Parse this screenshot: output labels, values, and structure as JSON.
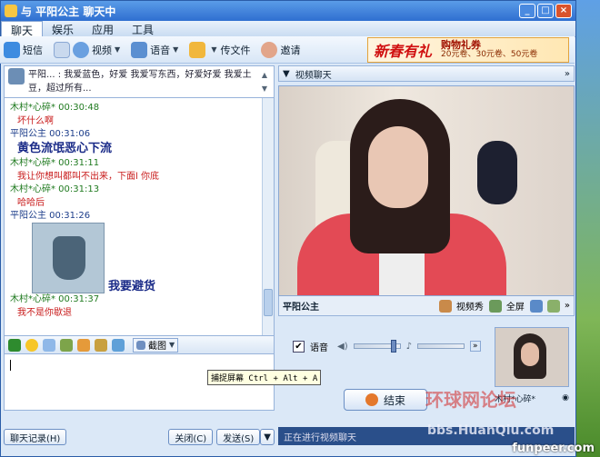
{
  "window": {
    "title": "与 平阳公主 聊天中"
  },
  "menu": {
    "items": [
      "聊天",
      "娱乐",
      "应用",
      "工具"
    ]
  },
  "toolbar": {
    "sms": "短信",
    "video": "视频",
    "voice": "语音",
    "send_file": "传文件",
    "invite": "邀请"
  },
  "ad": {
    "title": "新春有礼",
    "line1": "购物礼券",
    "line2": "20元卷、30元卷、50元卷"
  },
  "chat": {
    "header_text": "平阳... : 我爱蓝色，好爱 我爱写东西，好爱好爱 我爱土豆，超过所有...",
    "messages": [
      {
        "sender": "木村*心碎* 00:30:48",
        "text": "坏什么啊",
        "style": "normal"
      },
      {
        "sender": "平阳公主 00:31:06",
        "text": "黄色流氓恶心下流",
        "style": "big"
      },
      {
        "sender": "木村*心碎* 00:31:11",
        "text": "我让你想叫都叫不出来，下面l  你底",
        "style": "normal"
      },
      {
        "sender": "木村*心碎* 00:31:13",
        "text": "哈哈后",
        "style": "normal"
      },
      {
        "sender": "平阳公主 00:31:26",
        "text": "",
        "style": "sticker",
        "caption": "我要避货"
      },
      {
        "sender": "木村*心碎* 00:31:37",
        "text": "我不是你歇退",
        "style": "normal"
      }
    ]
  },
  "format": {
    "screenshot": "截图"
  },
  "tooltip": "捕捉屏幕 Ctrl + Alt + A",
  "bottom": {
    "history": "聊天记录(H)",
    "close": "关闭(C)",
    "send": "发送(S)"
  },
  "video": {
    "header": "视频聊天",
    "peer_name": "平阳公主",
    "show": "视频秀",
    "fullscreen": "全屏",
    "voice_label": "语音",
    "voice_checked": "✔",
    "end_button": "结束",
    "self_name": "木村*心碎*",
    "status": "正在进行视频聊天"
  },
  "watermark": {
    "text": "环球网论坛",
    "text2": "bbs.HuanQiu.com"
  },
  "site": "funpeer.com"
}
